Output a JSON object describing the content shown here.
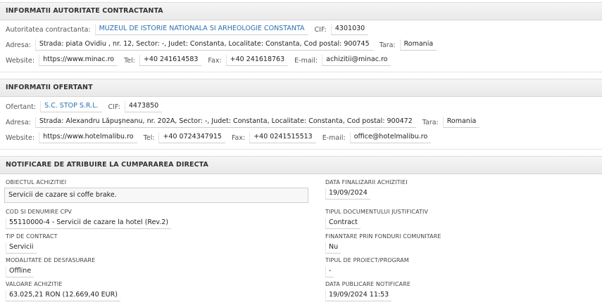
{
  "autoritate": {
    "header": "INFORMATII AUTORITATE CONTRACTANTA",
    "nume_label": "Autoritatea contractanta:",
    "nume": "MUZEUL DE ISTORIE NATIONALA SI ARHEOLOGIE CONSTANTA",
    "cif_label": "CIF:",
    "cif": "4301030",
    "adresa_label": "Adresa:",
    "adresa": "Strada: piata Ovidiu , nr. 12, Sector: -, Judet: Constanta, Localitate: Constanta, Cod postal: 900745",
    "tara_label": "Tara:",
    "tara": "Romania",
    "website_label": "Website:",
    "website": "https://www.minac.ro",
    "tel_label": "Tel:",
    "tel": "+40 241614583",
    "fax_label": "Fax:",
    "fax": "+40 241618763",
    "email_label": "E-mail:",
    "email": "achizitii@minac.ro"
  },
  "ofertant": {
    "header": "INFORMATII OFERTANT",
    "nume_label": "Ofertant:",
    "nume": "S.C. STOP S.R.L.",
    "cif_label": "CIF:",
    "cif": "4473850",
    "adresa_label": "Adresa:",
    "adresa": "Strada: Alexandru Lăpuşneanu, nr. 202A, Sector: -, Judet: Constanta, Localitate: Constanta, Cod postal: 900472",
    "tara_label": "Tara:",
    "tara": "Romania",
    "website_label": "Website:",
    "website": "https://www.hotelmalibu.ro",
    "tel_label": "Tel:",
    "tel": "+40 0724347915",
    "fax_label": "Fax:",
    "fax": "+40 0241515513",
    "email_label": "E-mail:",
    "email": "office@hotelmalibu.ro"
  },
  "notificare": {
    "header": "NOTIFICARE DE ATRIBUIRE LA CUMPARAREA DIRECTA",
    "obiect_label": "OBIECTUL ACHIZITIEI",
    "obiect": "Servicii de cazare si coffe brake.",
    "data_finalizarii_label": "DATA FINALIZARII ACHIZITIEI",
    "data_finalizarii": "19/09/2024",
    "cpv_label": "COD SI DENUMIRE CPV",
    "cpv": "55110000-4 - Servicii de cazare la hotel (Rev.2)",
    "tip_document_label": "TIPUL DOCUMENTULUI JUSTIFICATIV",
    "tip_document": "Contract",
    "tip_contract_label": "TIP DE CONTRACT",
    "tip_contract": "Servicii",
    "finantare_label": "FINANTARE PRIN FONDURI COMUNITARE",
    "finantare": "Nu",
    "modalitate_label": "MODALITATE DE DESFASURARE",
    "modalitate": "Offline",
    "tip_proiect_label": "TIPUL DE PROIECT/PROGRAM",
    "tip_proiect": "-",
    "valoare_label": "VALOARE ACHIZITIE",
    "valoare": "63.025,21 RON (12.669,40 EUR)",
    "data_publicare_label": "DATA PUBLICARE NOTIFICARE",
    "data_publicare": "19/09/2024 11:53"
  }
}
